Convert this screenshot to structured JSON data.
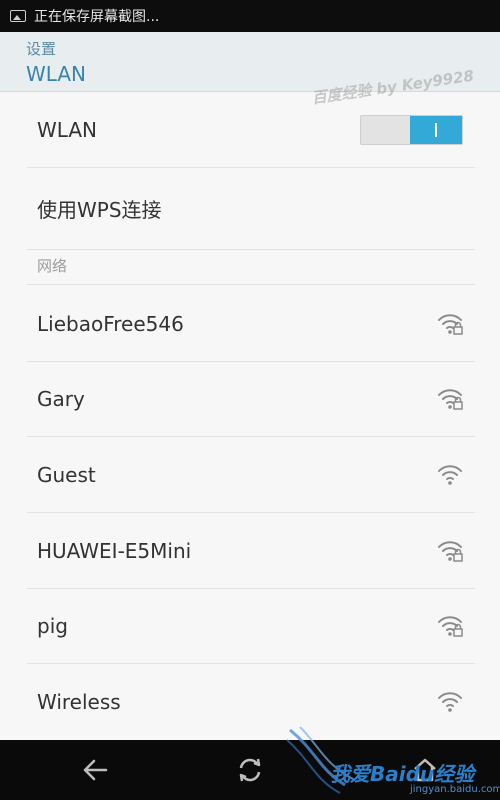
{
  "status_bar": {
    "text": "正在保存屏幕截图..."
  },
  "header": {
    "back_label": "设置",
    "title": "WLAN",
    "watermark": "百度经验 by Key9928"
  },
  "wlan_row": {
    "label": "WLAN",
    "toggle_state": "on"
  },
  "wps_row": {
    "label": "使用WPS连接"
  },
  "network_section": {
    "label": "网络"
  },
  "networks": [
    {
      "name": "LiebaoFree546",
      "secured": true
    },
    {
      "name": "Gary",
      "secured": true
    },
    {
      "name": "Guest",
      "secured": false
    },
    {
      "name": "HUAWEI-E5Mini",
      "secured": true
    },
    {
      "name": "pig",
      "secured": true
    },
    {
      "name": "Wireless",
      "secured": false
    }
  ],
  "nav_bar": {
    "back": "back-icon",
    "recent": "refresh-icon"
  },
  "branding": {
    "logo": "我爱Baidu经验",
    "url": "jingyan.baidu.com"
  },
  "colors": {
    "accent": "#33a9d8",
    "title": "#3a84a8",
    "header_bg": "#e8eef0"
  }
}
